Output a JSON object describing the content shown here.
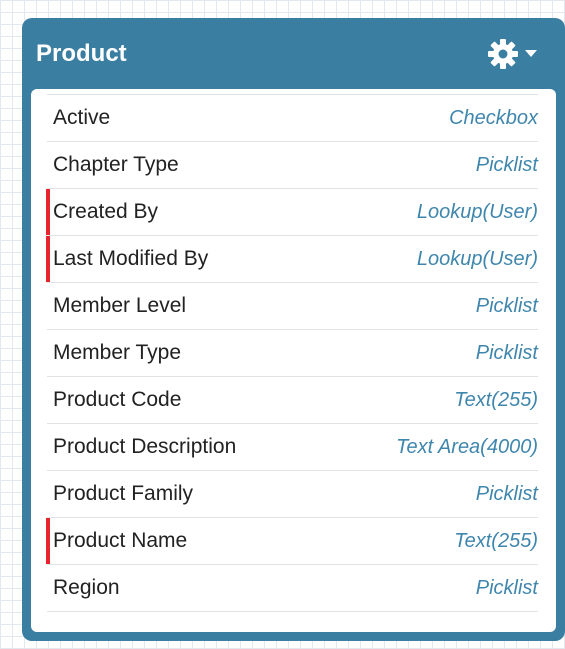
{
  "object": {
    "title": "Product",
    "header_color": "#3a7ea1",
    "required_indicator_color": "#e8242c",
    "type_text_color": "#3f86ad",
    "settings_icon": "gear-icon",
    "settings_dropdown_icon": "chevron-down-icon"
  },
  "fields": [
    {
      "name": "Active",
      "type": "Checkbox",
      "required": false
    },
    {
      "name": "Chapter Type",
      "type": "Picklist",
      "required": false
    },
    {
      "name": "Created By",
      "type": "Lookup(User)",
      "required": true
    },
    {
      "name": "Last Modified By",
      "type": "Lookup(User)",
      "required": true
    },
    {
      "name": "Member Level",
      "type": "Picklist",
      "required": false
    },
    {
      "name": "Member Type",
      "type": "Picklist",
      "required": false
    },
    {
      "name": "Product Code",
      "type": "Text(255)",
      "required": false
    },
    {
      "name": "Product Description",
      "type": "Text Area(4000)",
      "required": false
    },
    {
      "name": "Product Family",
      "type": "Picklist",
      "required": false
    },
    {
      "name": "Product Name",
      "type": "Text(255)",
      "required": true
    },
    {
      "name": "Region",
      "type": "Picklist",
      "required": false
    }
  ]
}
